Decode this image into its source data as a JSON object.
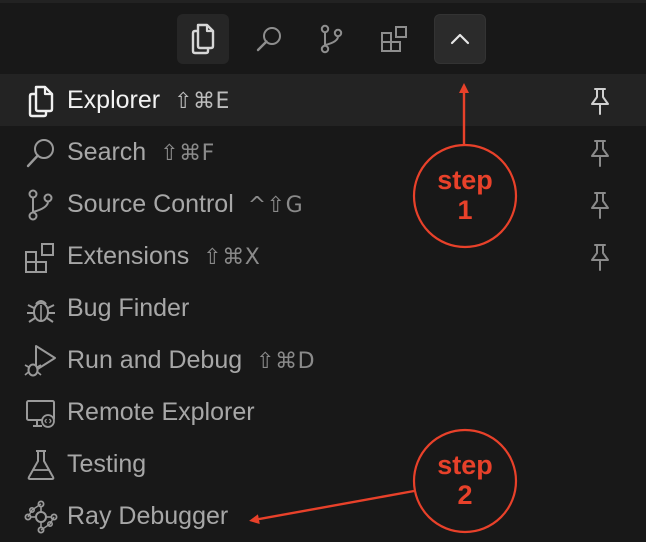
{
  "colors": {
    "background": "#181818",
    "selected_row": "#232323",
    "text_primary": "#f2f2f2",
    "text_secondary": "#a7a7a7",
    "annotation_red": "#e8412a"
  },
  "activity_bar": {
    "buttons": [
      {
        "icon": "files-icon",
        "active": true
      },
      {
        "icon": "search-icon",
        "active": false
      },
      {
        "icon": "source-control-icon",
        "active": false
      },
      {
        "icon": "extensions-icon",
        "active": false
      },
      {
        "icon": "chevron-up-icon",
        "active": false
      }
    ]
  },
  "menu": {
    "items": [
      {
        "label": "Explorer",
        "shortcut": "⇧⌘E",
        "icon": "files-icon",
        "pinned": true,
        "selected": true
      },
      {
        "label": "Search",
        "shortcut": "⇧⌘F",
        "icon": "search-icon",
        "pinned": true,
        "selected": false
      },
      {
        "label": "Source Control",
        "shortcut": "^⇧G",
        "icon": "source-control-icon",
        "pinned": true,
        "selected": false
      },
      {
        "label": "Extensions",
        "shortcut": "⇧⌘X",
        "icon": "extensions-icon",
        "pinned": true,
        "selected": false
      },
      {
        "label": "Bug Finder",
        "shortcut": "",
        "icon": "bug-icon",
        "pinned": false,
        "selected": false
      },
      {
        "label": "Run and Debug",
        "shortcut": "⇧⌘D",
        "icon": "run-debug-icon",
        "pinned": false,
        "selected": false
      },
      {
        "label": "Remote Explorer",
        "shortcut": "",
        "icon": "remote-explorer-icon",
        "pinned": false,
        "selected": false
      },
      {
        "label": "Testing",
        "shortcut": "",
        "icon": "beaker-icon",
        "pinned": false,
        "selected": false
      },
      {
        "label": "Ray Debugger",
        "shortcut": "",
        "icon": "ray-icon",
        "pinned": false,
        "selected": false
      }
    ]
  },
  "annotations": [
    {
      "line1": "step",
      "line2": "1"
    },
    {
      "line1": "step",
      "line2": "2"
    }
  ]
}
